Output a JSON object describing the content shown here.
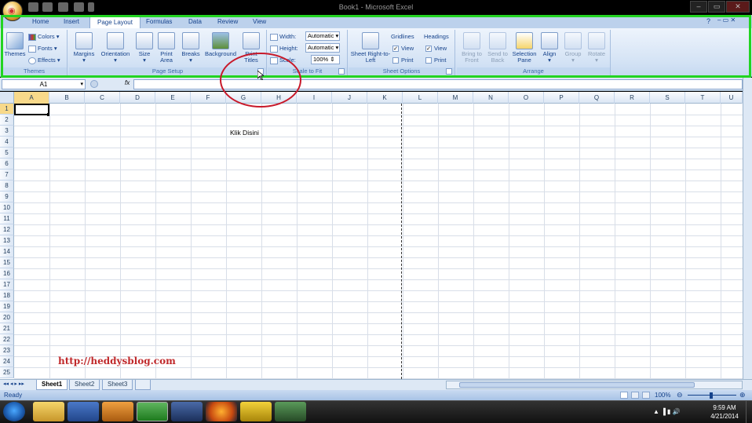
{
  "window": {
    "title": "Book1 - Microsoft Excel",
    "minimize": "–",
    "restore": "▭",
    "close": "✕"
  },
  "tabs": [
    "Home",
    "Insert",
    "Page Layout",
    "Formulas",
    "Data",
    "Review",
    "View"
  ],
  "active_tab": "Page Layout",
  "ribbon": {
    "themes": {
      "themes_label": "Themes",
      "colors_label": "Colors",
      "fonts_label": "Fonts",
      "effects_label": "Effects",
      "group_label": "Themes"
    },
    "page_setup": {
      "margins": "Margins",
      "orientation": "Orientation",
      "size": "Size",
      "print_area": "Print Area",
      "breaks": "Breaks",
      "background": "Background",
      "print_titles": "Print Titles",
      "group_label": "Page Setup"
    },
    "scale_to_fit": {
      "width_label": "Width:",
      "width_value": "Automatic",
      "height_label": "Height:",
      "height_value": "Automatic",
      "scale_label": "Scale:",
      "scale_value": "100%",
      "group_label": "Scale to Fit"
    },
    "sheet_options": {
      "sheet_rtl": "Sheet Right-to-Left",
      "gridlines_label": "Gridlines",
      "gridlines_view": "View",
      "gridlines_print": "Print",
      "headings_label": "Headings",
      "headings_view": "View",
      "headings_print": "Print",
      "group_label": "Sheet Options"
    },
    "arrange": {
      "bring_to_front": "Bring to Front",
      "send_to_back": "Send to Back",
      "selection_pane": "Selection Pane",
      "align": "Align",
      "group": "Group",
      "rotate": "Rotate",
      "group_label": "Arrange"
    }
  },
  "formula_bar": {
    "name_box": "A1",
    "fx_label": "fx",
    "formula_value": ""
  },
  "columns": [
    "A",
    "B",
    "C",
    "D",
    "E",
    "F",
    "G",
    "H",
    "I",
    "J",
    "K",
    "L",
    "M",
    "N",
    "O",
    "P",
    "Q",
    "R",
    "S",
    "T",
    "U"
  ],
  "rows": [
    "1",
    "2",
    "3",
    "4",
    "5",
    "6",
    "7",
    "8",
    "9",
    "10",
    "11",
    "12",
    "13",
    "14",
    "15",
    "16",
    "17",
    "18",
    "19",
    "20",
    "21",
    "22",
    "23",
    "24",
    "25"
  ],
  "cells": {
    "G3": "Klik Disini"
  },
  "watermark": "http://heddysblog.com",
  "sheet_tabs": [
    "Sheet1",
    "Sheet2",
    "Sheet3"
  ],
  "status": {
    "text": "Ready",
    "zoom": "100%"
  },
  "taskbar": {
    "time": "9:59 AM",
    "date": "4/21/2014"
  },
  "colors": {
    "highlight": "#22d422",
    "circle": "#c8192a",
    "watermark": "#c0292b"
  }
}
